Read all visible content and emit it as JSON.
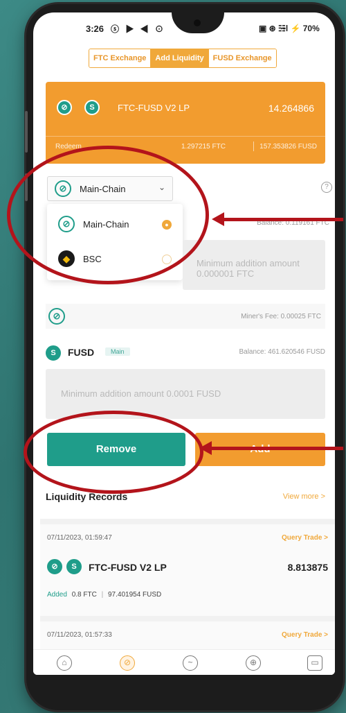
{
  "status_bar": {
    "time": "3:26",
    "left_icons": "ⓢ ▶ ◀ ⊙",
    "right_icons": "▣ ⊛ ☷̴l ⚡ 70%"
  },
  "tabs": [
    {
      "label": "FTC Exchange",
      "active": false
    },
    {
      "label": "Add Liquidity",
      "active": true
    },
    {
      "label": "FUSD Exchange",
      "active": false
    }
  ],
  "lp_card": {
    "title": "FTC-FUSD  V2 LP",
    "amount": "14.264866",
    "redeem_label": "Redeem",
    "ftc_value": "1.297215 FTC",
    "fusd_value": "157.353826 FUSD",
    "coin1_letter": "⊘",
    "coin2_letter": "S"
  },
  "chain_selector": {
    "selected": "Main-Chain",
    "chevron": "⌄",
    "help": "?",
    "options": [
      {
        "label": "Main-Chain",
        "selected": true
      },
      {
        "label": "BSC",
        "selected": false
      }
    ]
  },
  "ftc": {
    "balance": "Balance: 0.119161 FTC",
    "placeholder": "Minimum addition amount 0.000001 FTC",
    "miner_fee": "Miner's Fee: 0.00025 FTC"
  },
  "fusd": {
    "label": "FUSD",
    "badge": "Main",
    "balance": "Balance: 461.620546 FUSD",
    "placeholder": "Minimum addition amount 0.0001 FUSD"
  },
  "buttons": {
    "remove": "Remove",
    "add": "Add"
  },
  "records": {
    "title": "Liquidity Records",
    "view_more": "View more >",
    "items": [
      {
        "date": "07/11/2023, 01:59:47",
        "query": "Query Trade >",
        "name": "FTC-FUSD  V2 LP",
        "amount": "8.813875",
        "added_tag": "Added",
        "added_ftc": "0.8 FTC",
        "added_fusd": "97.401954 FUSD"
      },
      {
        "date": "07/11/2023, 01:57:33",
        "query": "Query Trade >"
      }
    ]
  },
  "bottom_nav": [
    "home-icon",
    "exchange-icon",
    "chart-icon",
    "compass-icon",
    "wallet-icon"
  ],
  "colors": {
    "accent_orange": "#f29c2f",
    "accent_teal": "#1f9d8a",
    "annotation_red": "#b3141b"
  }
}
